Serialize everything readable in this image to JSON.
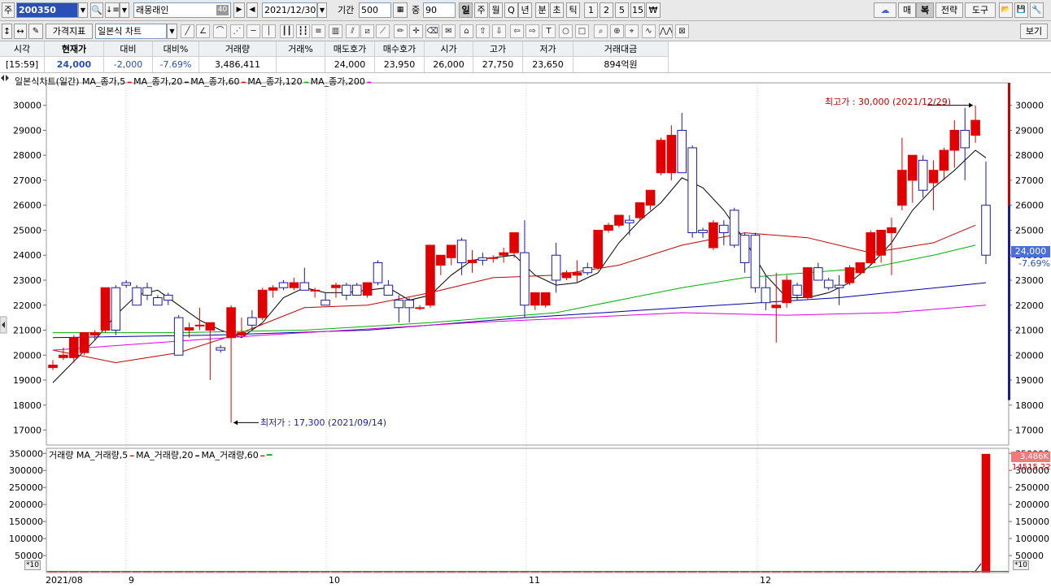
{
  "toolbar1": {
    "type_label": "주",
    "code": "200350",
    "name": "래몽래인",
    "name_badge": "40",
    "date": "2021/12/30",
    "period_label": "기간",
    "period_value": "500",
    "count_label": "중",
    "count_value": "90",
    "intervals": [
      "일",
      "주",
      "월",
      "Q",
      "년",
      "분",
      "초",
      "틱",
      "1",
      "2",
      "5",
      "15"
    ],
    "selected_interval": "일",
    "won_icon": "₩",
    "right_buttons": [
      "매",
      "복",
      "전략",
      "도구"
    ]
  },
  "toolbar2": {
    "price_indicator": "가격지표",
    "chart_type": "일본식 차트",
    "right_button": "보기"
  },
  "info": {
    "headers": [
      "시각",
      "현재가",
      "대비",
      "대비%",
      "거래량",
      "거래%",
      "매도호가",
      "매수호가",
      "시가",
      "고가",
      "저가",
      "거래대금"
    ],
    "values": [
      "[15:59]",
      "24,000",
      "-2,000",
      "-7.69%",
      "3,486,411",
      "",
      "24,000",
      "23,950",
      "26,000",
      "27,750",
      "23,650",
      "894억원"
    ]
  },
  "price_panel": {
    "legend_title": "일본식차트(일간)",
    "legend_items": [
      {
        "label": "MA_종가,5",
        "color": "#e00000"
      },
      {
        "label": "MA_종가,20",
        "color": "#000000"
      },
      {
        "label": "MA_종가,60",
        "color": "#e00000"
      },
      {
        "label": "MA_종가,120",
        "color": "#00b000"
      },
      {
        "label": "MA_종가,200",
        "color": "#e000e0"
      }
    ],
    "high_annotation": "최고가 : 30,000 (2021/12/29)",
    "low_annotation": "최저가 : 17,300 (2021/09/14)",
    "current_price_label": "24,000",
    "current_pct_label": "-7.69%"
  },
  "volume_panel": {
    "legend_title": "거래량",
    "legend_items": [
      {
        "label": "MA_거래량,5",
        "color": "#e00000"
      },
      {
        "label": "MA_거래량,20",
        "color": "#000000"
      },
      {
        "label": "MA_거래량,60",
        "color": "#e00000"
      }
    ],
    "end_color": "#00b000",
    "current_volume_label": "3,486K",
    "current_pct_label": "14515.22%",
    "multiplier_label": "*10"
  },
  "chart_data": {
    "type": "candlestick",
    "price_axis": {
      "ticks": [
        17000,
        18000,
        19000,
        20000,
        21000,
        22000,
        23000,
        24000,
        25000,
        26000,
        27000,
        28000,
        29000,
        30000
      ],
      "ylim": [
        16400,
        30900
      ]
    },
    "volume_axis": {
      "ticks": [
        50000,
        100000,
        150000,
        200000,
        250000,
        300000,
        350000
      ],
      "ylim": [
        0,
        365000
      ]
    },
    "x_axis_labels": [
      "2021/08",
      "9",
      "10",
      "11",
      "12"
    ],
    "candles": [
      {
        "o": 19500,
        "h": 19800,
        "l": 19400,
        "c": 19600
      },
      {
        "o": 19900,
        "h": 20300,
        "l": 19800,
        "c": 20000
      },
      {
        "o": 19900,
        "h": 20800,
        "l": 19700,
        "c": 20700
      },
      {
        "o": 20100,
        "h": 20900,
        "l": 20000,
        "c": 20900
      },
      {
        "o": 20800,
        "h": 21000,
        "l": 20600,
        "c": 20900
      },
      {
        "o": 21000,
        "h": 22700,
        "l": 20900,
        "c": 22700
      },
      {
        "o": 22700,
        "h": 22800,
        "l": 20800,
        "c": 21000
      },
      {
        "o": 22900,
        "h": 23000,
        "l": 22700,
        "c": 22800
      },
      {
        "o": 22700,
        "h": 22800,
        "l": 22000,
        "c": 22000
      },
      {
        "o": 22700,
        "h": 22900,
        "l": 22200,
        "c": 22400
      },
      {
        "o": 22300,
        "h": 22400,
        "l": 22000,
        "c": 22000
      },
      {
        "o": 22400,
        "h": 22500,
        "l": 22000,
        "c": 22200
      },
      {
        "o": 21500,
        "h": 21600,
        "l": 20000,
        "c": 20000
      },
      {
        "o": 21000,
        "h": 21300,
        "l": 20700,
        "c": 21100
      },
      {
        "o": 21200,
        "h": 21900,
        "l": 21000,
        "c": 21200
      },
      {
        "o": 21000,
        "h": 21300,
        "l": 19000,
        "c": 21300
      },
      {
        "o": 20300,
        "h": 20400,
        "l": 20100,
        "c": 20200
      },
      {
        "o": 20700,
        "h": 22000,
        "l": 17300,
        "c": 21900
      },
      {
        "o": 20800,
        "h": 21500,
        "l": 20700,
        "c": 20900
      },
      {
        "o": 21500,
        "h": 21800,
        "l": 21000,
        "c": 21200
      },
      {
        "o": 21500,
        "h": 22700,
        "l": 21400,
        "c": 22600
      },
      {
        "o": 22600,
        "h": 22800,
        "l": 22300,
        "c": 22700
      },
      {
        "o": 22900,
        "h": 23000,
        "l": 22600,
        "c": 22700
      },
      {
        "o": 22700,
        "h": 23100,
        "l": 22600,
        "c": 22900
      },
      {
        "o": 22900,
        "h": 23500,
        "l": 22600,
        "c": 22600
      },
      {
        "o": 22600,
        "h": 22700,
        "l": 22300,
        "c": 22600
      },
      {
        "o": 22200,
        "h": 22500,
        "l": 22100,
        "c": 22000
      },
      {
        "o": 22700,
        "h": 22900,
        "l": 22300,
        "c": 22800
      },
      {
        "o": 22800,
        "h": 22900,
        "l": 22200,
        "c": 22400
      },
      {
        "o": 22800,
        "h": 22900,
        "l": 22400,
        "c": 22400
      },
      {
        "o": 22400,
        "h": 22900,
        "l": 22300,
        "c": 22900
      },
      {
        "o": 23700,
        "h": 23800,
        "l": 22800,
        "c": 22900
      },
      {
        "o": 22800,
        "h": 23000,
        "l": 22400,
        "c": 22400
      },
      {
        "o": 22200,
        "h": 22400,
        "l": 21300,
        "c": 21900
      },
      {
        "o": 22200,
        "h": 22300,
        "l": 21300,
        "c": 21900
      },
      {
        "o": 21900,
        "h": 22000,
        "l": 21800,
        "c": 21900
      },
      {
        "o": 22000,
        "h": 24400,
        "l": 21900,
        "c": 24400
      },
      {
        "o": 23600,
        "h": 23900,
        "l": 23200,
        "c": 24000
      },
      {
        "o": 23900,
        "h": 24400,
        "l": 23600,
        "c": 24400
      },
      {
        "o": 24600,
        "h": 24700,
        "l": 23200,
        "c": 23700
      },
      {
        "o": 23700,
        "h": 24200,
        "l": 23300,
        "c": 23800
      },
      {
        "o": 23900,
        "h": 24100,
        "l": 23600,
        "c": 23800
      },
      {
        "o": 23900,
        "h": 24000,
        "l": 23700,
        "c": 23900
      },
      {
        "o": 24000,
        "h": 24300,
        "l": 23700,
        "c": 24100
      },
      {
        "o": 24100,
        "h": 24900,
        "l": 23900,
        "c": 24900
      },
      {
        "o": 24100,
        "h": 25400,
        "l": 21500,
        "c": 22000
      },
      {
        "o": 22000,
        "h": 22500,
        "l": 21800,
        "c": 22500
      },
      {
        "o": 22000,
        "h": 22400,
        "l": 21900,
        "c": 22500
      },
      {
        "o": 24000,
        "h": 24500,
        "l": 22500,
        "c": 23000
      },
      {
        "o": 23100,
        "h": 23400,
        "l": 23000,
        "c": 23300
      },
      {
        "o": 23200,
        "h": 23800,
        "l": 22900,
        "c": 23300
      },
      {
        "o": 23500,
        "h": 23700,
        "l": 23200,
        "c": 23300
      },
      {
        "o": 23500,
        "h": 25000,
        "l": 23400,
        "c": 25000
      },
      {
        "o": 25000,
        "h": 25300,
        "l": 24900,
        "c": 25200
      },
      {
        "o": 25200,
        "h": 25600,
        "l": 25100,
        "c": 25600
      },
      {
        "o": 25400,
        "h": 25600,
        "l": 24800,
        "c": 25300
      },
      {
        "o": 25500,
        "h": 26100,
        "l": 25400,
        "c": 26100
      },
      {
        "o": 26000,
        "h": 26300,
        "l": 25800,
        "c": 26600
      },
      {
        "o": 27300,
        "h": 28700,
        "l": 27200,
        "c": 28600
      },
      {
        "o": 27300,
        "h": 29200,
        "l": 27000,
        "c": 28800
      },
      {
        "o": 29000,
        "h": 29700,
        "l": 28200,
        "c": 27300
      },
      {
        "o": 28300,
        "h": 28400,
        "l": 24700,
        "c": 24900
      },
      {
        "o": 25000,
        "h": 25100,
        "l": 24700,
        "c": 24900
      },
      {
        "o": 24300,
        "h": 25400,
        "l": 24200,
        "c": 25300
      },
      {
        "o": 25200,
        "h": 25400,
        "l": 24400,
        "c": 24900
      },
      {
        "o": 25800,
        "h": 25900,
        "l": 24300,
        "c": 24400
      },
      {
        "o": 24800,
        "h": 24900,
        "l": 23300,
        "c": 23700
      },
      {
        "o": 24800,
        "h": 24900,
        "l": 22500,
        "c": 22700
      },
      {
        "o": 22700,
        "h": 23200,
        "l": 21800,
        "c": 22100
      },
      {
        "o": 21900,
        "h": 23300,
        "l": 20500,
        "c": 22000
      },
      {
        "o": 22100,
        "h": 23200,
        "l": 21900,
        "c": 23000
      },
      {
        "o": 22800,
        "h": 22900,
        "l": 22200,
        "c": 22400
      },
      {
        "o": 22300,
        "h": 23500,
        "l": 22200,
        "c": 23500
      },
      {
        "o": 23500,
        "h": 23700,
        "l": 23000,
        "c": 23000
      },
      {
        "o": 23000,
        "h": 23100,
        "l": 22600,
        "c": 22700
      },
      {
        "o": 22800,
        "h": 23200,
        "l": 22000,
        "c": 22700
      },
      {
        "o": 22900,
        "h": 23600,
        "l": 22800,
        "c": 23500
      },
      {
        "o": 23300,
        "h": 23700,
        "l": 23200,
        "c": 23700
      },
      {
        "o": 23700,
        "h": 25000,
        "l": 23600,
        "c": 24900
      },
      {
        "o": 24000,
        "h": 25000,
        "l": 23700,
        "c": 25000
      },
      {
        "o": 24900,
        "h": 25500,
        "l": 23200,
        "c": 25100
      },
      {
        "o": 26000,
        "h": 28700,
        "l": 25800,
        "c": 27400
      },
      {
        "o": 27000,
        "h": 28000,
        "l": 26100,
        "c": 28000
      },
      {
        "o": 27800,
        "h": 28000,
        "l": 26300,
        "c": 26600
      },
      {
        "o": 26900,
        "h": 27800,
        "l": 25800,
        "c": 27400
      },
      {
        "o": 27400,
        "h": 28300,
        "l": 27000,
        "c": 28200
      },
      {
        "o": 28200,
        "h": 29400,
        "l": 27500,
        "c": 29000
      },
      {
        "o": 29000,
        "h": 29900,
        "l": 27000,
        "c": 28300
      },
      {
        "o": 28800,
        "h": 30000,
        "l": 28500,
        "c": 29400
      },
      {
        "o": 26000,
        "h": 27750,
        "l": 23650,
        "c": 24000
      }
    ],
    "ma_series": [
      {
        "name": "MA_종가,5",
        "color": "#000000",
        "points": [
          [
            0,
            18900
          ],
          [
            4,
            20600
          ],
          [
            6,
            21600
          ],
          [
            8,
            22400
          ],
          [
            10,
            22600
          ],
          [
            12,
            22000
          ],
          [
            14,
            21400
          ],
          [
            16,
            21000
          ],
          [
            18,
            20700
          ],
          [
            20,
            21300
          ],
          [
            22,
            22300
          ],
          [
            24,
            22700
          ],
          [
            26,
            22500
          ],
          [
            28,
            22500
          ],
          [
            30,
            22600
          ],
          [
            32,
            22700
          ],
          [
            34,
            22200
          ],
          [
            36,
            22400
          ],
          [
            38,
            23200
          ],
          [
            40,
            23800
          ],
          [
            42,
            23900
          ],
          [
            44,
            24000
          ],
          [
            46,
            23200
          ],
          [
            48,
            22800
          ],
          [
            50,
            22900
          ],
          [
            52,
            23300
          ],
          [
            54,
            24500
          ],
          [
            56,
            25400
          ],
          [
            58,
            26100
          ],
          [
            60,
            27100
          ],
          [
            62,
            26700
          ],
          [
            64,
            25800
          ],
          [
            66,
            24600
          ],
          [
            68,
            23200
          ],
          [
            70,
            22300
          ],
          [
            72,
            22300
          ],
          [
            74,
            22500
          ],
          [
            76,
            22900
          ],
          [
            78,
            23600
          ],
          [
            80,
            24500
          ],
          [
            82,
            25800
          ],
          [
            84,
            26700
          ],
          [
            86,
            27400
          ],
          [
            88,
            28200
          ],
          [
            89,
            27900
          ]
        ]
      },
      {
        "name": "MA_종가,20",
        "color": "#c00000",
        "points": [
          [
            0,
            20200
          ],
          [
            6,
            19700
          ],
          [
            12,
            20100
          ],
          [
            18,
            20900
          ],
          [
            24,
            21900
          ],
          [
            30,
            22000
          ],
          [
            36,
            22500
          ],
          [
            42,
            23100
          ],
          [
            48,
            23200
          ],
          [
            54,
            23600
          ],
          [
            60,
            24400
          ],
          [
            66,
            24900
          ],
          [
            72,
            24700
          ],
          [
            78,
            24100
          ],
          [
            84,
            24500
          ],
          [
            88,
            25200
          ]
        ]
      },
      {
        "name": "MA_종가,60",
        "color": "#00b000",
        "points": [
          [
            0,
            20900
          ],
          [
            12,
            20900
          ],
          [
            24,
            21000
          ],
          [
            36,
            21300
          ],
          [
            48,
            21700
          ],
          [
            60,
            22700
          ],
          [
            66,
            23100
          ],
          [
            72,
            23300
          ],
          [
            78,
            23500
          ],
          [
            84,
            24000
          ],
          [
            88,
            24400
          ]
        ]
      },
      {
        "name": "MA_종가,120",
        "color": "#0000a0",
        "points": [
          [
            0,
            20700
          ],
          [
            15,
            20800
          ],
          [
            30,
            21000
          ],
          [
            45,
            21500
          ],
          [
            60,
            21900
          ],
          [
            75,
            22300
          ],
          [
            89,
            22900
          ]
        ]
      },
      {
        "name": "MA_종가,200",
        "color": "#e000e0",
        "points": [
          [
            0,
            20200
          ],
          [
            20,
            20800
          ],
          [
            40,
            21300
          ],
          [
            60,
            21700
          ],
          [
            70,
            21600
          ],
          [
            80,
            21700
          ],
          [
            89,
            22000
          ]
        ]
      }
    ],
    "volume_last": 348641,
    "volume_base": 2000
  }
}
